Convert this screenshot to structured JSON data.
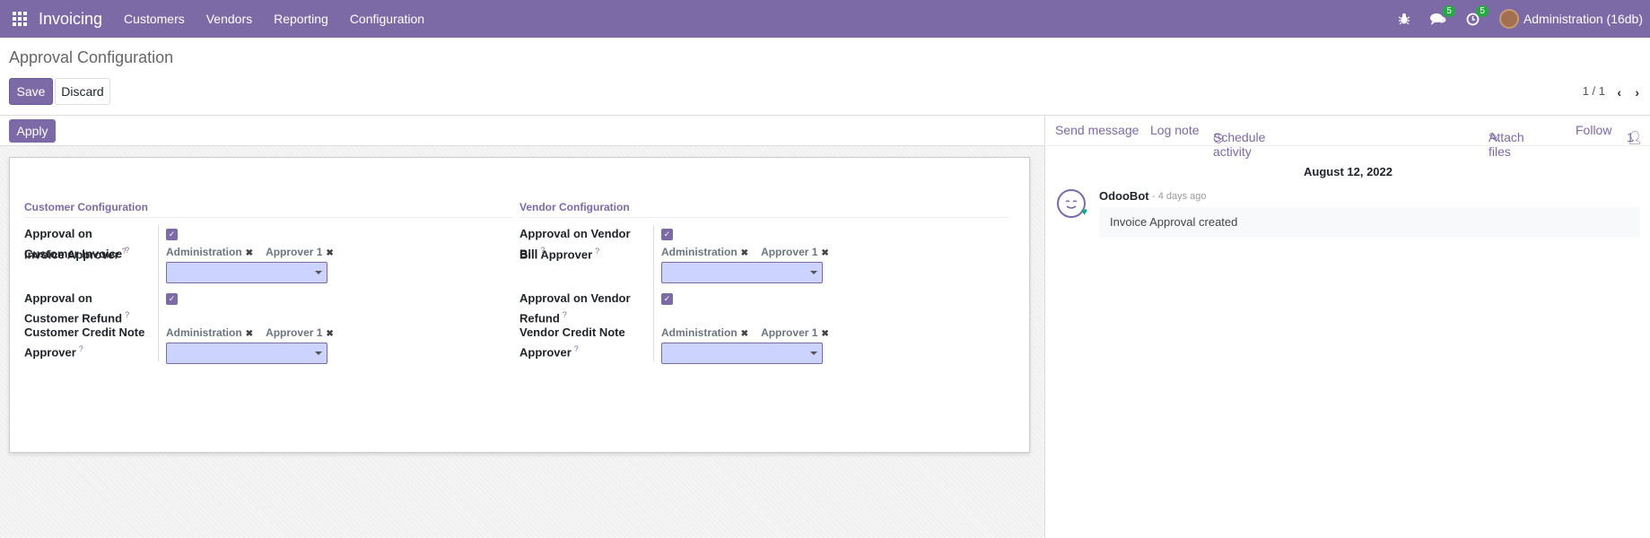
{
  "navbar": {
    "app_title": "Invoicing",
    "menu": [
      "Customers",
      "Vendors",
      "Reporting",
      "Configuration"
    ],
    "messages_badge": "5",
    "activities_badge": "5",
    "user": "Administration (16db)"
  },
  "control": {
    "title": "Approval Configuration",
    "save_label": "Save",
    "discard_label": "Discard",
    "pager": "1 / 1"
  },
  "form": {
    "apply_label": "Apply",
    "customer": {
      "title": "Customer Configuration",
      "approval_invoice_label": "Approval on Customer Invoice",
      "invoice_approver_label": "Invoice Approver",
      "approval_refund_label": "Approval on Customer Refund",
      "credit_note_approver_label": "Customer Credit Note Approver",
      "tags": [
        "Administration",
        "Approver 1"
      ]
    },
    "vendor": {
      "title": "Vendor Configuration",
      "approval_bill_label": "Approval on Vendor Bill",
      "bill_approver_label": "Bill Approver",
      "approval_refund_label": "Approval on Vendor Refund",
      "credit_note_approver_label": "Vendor Credit Note Approver",
      "tags": [
        "Administration",
        "Approver 1"
      ]
    }
  },
  "chatter": {
    "send_message": "Send message",
    "log_note": "Log note",
    "schedule_activity": "Schedule activity",
    "attach_files": "Attach files",
    "follow": "Follow",
    "followers_count": "1",
    "date": "August 12, 2022",
    "author": "OdooBot",
    "time": "- 4 days ago",
    "body": "Invoice Approval created"
  },
  "colors": {
    "primary": "#7c6aa6",
    "badge": "#28a745",
    "select_bg": "#ccd3ff"
  }
}
